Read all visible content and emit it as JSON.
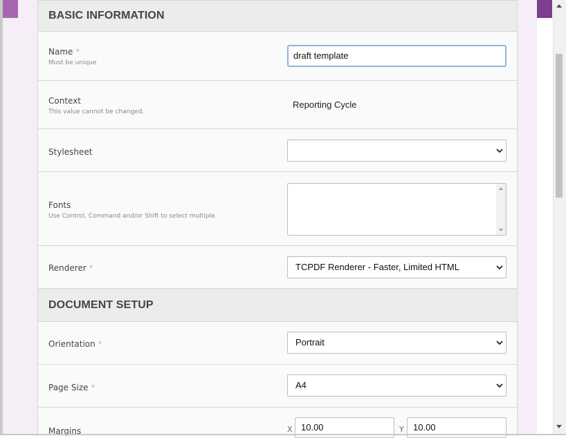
{
  "sections": {
    "basic": {
      "title": "BASIC INFORMATION"
    },
    "document": {
      "title": "DOCUMENT SETUP"
    }
  },
  "fields": {
    "name": {
      "label": "Name",
      "required_mark": "*",
      "hint": "Must be unique",
      "value": "draft template"
    },
    "context": {
      "label": "Context",
      "hint": "This value cannot be changed.",
      "value": "Reporting Cycle"
    },
    "stylesheet": {
      "label": "Stylesheet",
      "selected": ""
    },
    "fonts": {
      "label": "Fonts",
      "hint": "Use Control, Command and/or Shift to select multiple."
    },
    "renderer": {
      "label": "Renderer",
      "required_mark": "*",
      "selected": "TCPDF Renderer - Faster, Limited HTML"
    },
    "orientation": {
      "label": "Orientation",
      "required_mark": "*",
      "selected": "Portrait"
    },
    "page_size": {
      "label": "Page Size",
      "required_mark": "*",
      "selected": "A4"
    },
    "margins": {
      "label": "Margins",
      "x_label": "X",
      "x_value": "10.00",
      "y_label": "Y",
      "y_value": "10.00"
    }
  },
  "icons": {
    "select_chevron": "chevron-down-icon",
    "scroll_up": "scroll-up-arrow-icon",
    "scroll_down": "scroll-down-arrow-icon"
  },
  "colors": {
    "accent_purple_light": "#a866b0",
    "accent_purple_dark": "#7b3f8c",
    "focus_border": "#8fb3d9",
    "section_header_bg": "#ececec",
    "row_bg": "#fafafa"
  }
}
